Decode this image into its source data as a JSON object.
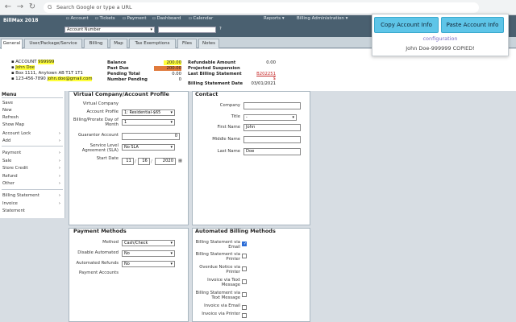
{
  "browser": {
    "omnibox_placeholder": "Search Google or type a URL"
  },
  "app": {
    "brand": "BillMax 2018",
    "topnav": [
      "Account",
      "Tickets",
      "Payment",
      "Dashboard",
      "Calendar",
      "Reports",
      "Billing Administration"
    ],
    "account_select": "Account Number",
    "help": "?"
  },
  "tabs": [
    "General",
    "User/Package/Service",
    "Billing",
    "Map",
    "Tax Exemptions",
    "Files",
    "Notes"
  ],
  "summary": {
    "account_label": "ACCOUNT",
    "account_number": "999999",
    "name": "John Doe",
    "address": "Box 1111, Anytown AB T1T 1T1",
    "phone": "123-456-7890",
    "email": "john.doe@gmail.com",
    "balance_label": "Balance",
    "balance": "200.00",
    "past_due_label": "Past Due",
    "past_due": "200.00",
    "pending_total_label": "Pending Total",
    "pending_total": "0.00",
    "number_pending_label": "Number Pending",
    "number_pending": "0",
    "refundable_label": "Refundable Amount",
    "refundable": "0.00",
    "projected_label": "Projected Suspension",
    "last_stmt_label": "Last Billing Statement",
    "last_stmt": "B202251",
    "last_stmt_amount": "$",
    "stmt_date_label": "Billing Statement Date",
    "stmt_date": "03/01/2021"
  },
  "menu": {
    "title": "Menu",
    "group1": [
      "Save",
      "New",
      "Refresh",
      "Show Map",
      "Account Lock",
      "Add"
    ],
    "group2": [
      "Payment",
      "Sale",
      "Store Credit",
      "Refund",
      "Other"
    ],
    "group3": [
      "Billing Statement",
      "Invoice",
      "Statement"
    ]
  },
  "virtual_company": {
    "title": "Virtual Company/Account Profile",
    "vc_label": "Virtual Company",
    "profile_label": "Account Profile",
    "profile_value": "1: Residential-$65",
    "prorate_label": "Billing/Prorate Day of Month",
    "prorate_value": "1",
    "guarantor_label": "Guarantor Account",
    "guarantor_value": "0",
    "sla_label": "Service Level Agreement (SLA)",
    "sla_value": "No SLA",
    "start_label": "Start Date",
    "start_month": "11",
    "start_day": "16",
    "start_year": "2020"
  },
  "contact": {
    "title": "Contact",
    "company_label": "Company",
    "title_label": "Title",
    "title_value": "-",
    "first_label": "First Name",
    "first_value": "John",
    "middle_label": "Middle Name",
    "last_label": "Last Name",
    "last_value": "Doe"
  },
  "payment_methods": {
    "title": "Payment Methods",
    "method_label": "Method",
    "method_value": "Cash/Check",
    "disable_label": "Disable Automated",
    "disable_value": "No",
    "refunds_label": "Automated Refunds",
    "refunds_value": "No",
    "accounts_label": "Payment Accounts"
  },
  "auto_billing": {
    "title": "Automated Billing Methods",
    "items": [
      {
        "label": "Billing Statement via Email",
        "checked": true
      },
      {
        "label": "Billing Statement via Printer",
        "checked": false
      },
      {
        "label": "Overdue Notice via Printer",
        "checked": false
      },
      {
        "label": "Invoice via Text Message",
        "checked": false
      },
      {
        "label": "Billing Statement via Text Message",
        "checked": false
      },
      {
        "label": "Invoice via Email",
        "checked": false
      },
      {
        "label": "Invoice via Printer",
        "checked": false
      }
    ]
  },
  "popup": {
    "copy_label": "Copy Account Info",
    "paste_label": "Paste Account Info",
    "config_link": "configuration",
    "status": "John Doe-999999 COPIED!"
  },
  "colors": {
    "accent": "#5ec5e8",
    "header": "#4a6070",
    "highlight": "#ffff3a",
    "pastdue": "#e07a3c"
  }
}
